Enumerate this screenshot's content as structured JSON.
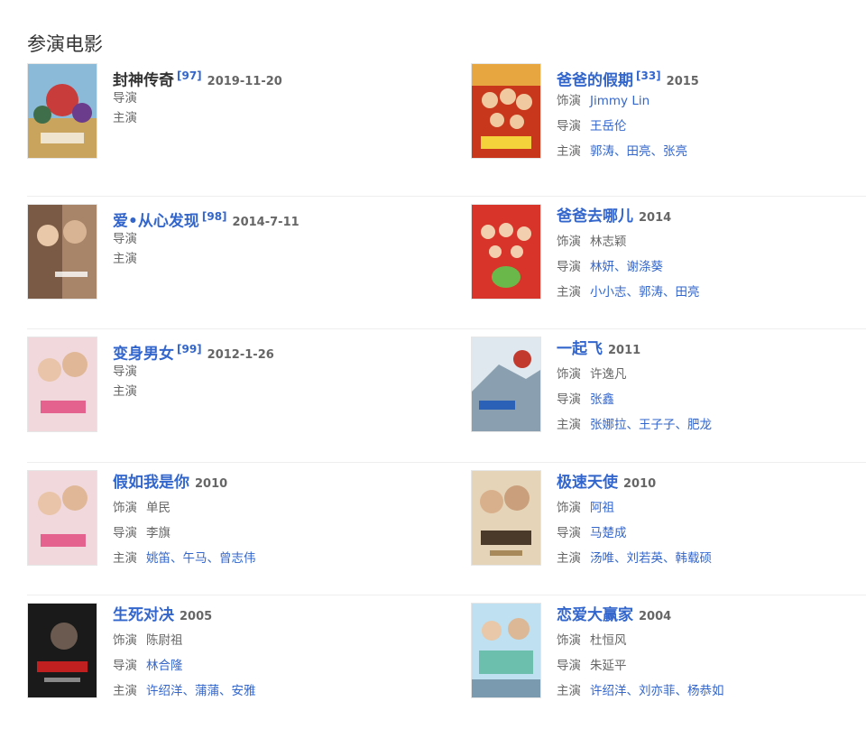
{
  "section_title": "参演电影",
  "films": [
    {
      "title": "封神传奇",
      "cite": "[97]",
      "date": "2019-11-20",
      "director_label": "导演",
      "actors_label": "主演"
    },
    {
      "title": "爸爸的假期",
      "cite": "[33]",
      "date": "2015",
      "role_label": "饰演",
      "role": "Jimmy Lin",
      "director_label": "导演",
      "director": "王岳伦",
      "actors_label": "主演",
      "actors": "郭涛、田亮、张亮"
    },
    {
      "title": "爱•从心发现",
      "cite": "[98]",
      "date": "2014-7-11",
      "director_label": "导演",
      "actors_label": "主演"
    },
    {
      "title": "爸爸去哪儿",
      "date": "2014",
      "role_label": "饰演",
      "role": "林志颖",
      "director_label": "导演",
      "director": "林妍、谢涤葵",
      "actors_label": "主演",
      "actors": "小小志、郭涛、田亮"
    },
    {
      "title": "变身男女",
      "cite": "[99]",
      "date": "2012-1-26",
      "director_label": "导演",
      "actors_label": "主演"
    },
    {
      "title": "一起飞",
      "date": "2011",
      "role_label": "饰演",
      "role": "许逸凡",
      "director_label": "导演",
      "director": "张鑫",
      "actors_label": "主演",
      "actors": "张娜拉、王子子、肥龙"
    },
    {
      "title": "假如我是你",
      "date": "2010",
      "role_label": "饰演",
      "role": "单民",
      "director_label": "导演",
      "director": "李旗",
      "actors_label": "主演",
      "actors": "姚笛、午马、曾志伟"
    },
    {
      "title": "极速天使",
      "date": "2010",
      "role_label": "饰演",
      "role": "阿祖",
      "director_label": "导演",
      "director": "马楚成",
      "actors_label": "主演",
      "actors": "汤唯、刘若英、韩载硕"
    },
    {
      "title": "生死对决",
      "date": "2005",
      "role_label": "饰演",
      "role": "陈尉祖",
      "director_label": "导演",
      "director": "林合隆",
      "actors_label": "主演",
      "actors": "许绍洋、蒲蒲、安雅"
    },
    {
      "title": "恋爱大赢家",
      "date": "2004",
      "role_label": "饰演",
      "role": "杜恒风",
      "director_label": "导演",
      "director": "朱延平",
      "actors_label": "主演",
      "actors": "许绍洋、刘亦菲、杨恭如"
    }
  ],
  "colors": {
    "link": "#3366cc",
    "text": "#666666",
    "heading": "#333333",
    "divider": "#eeeeee"
  }
}
